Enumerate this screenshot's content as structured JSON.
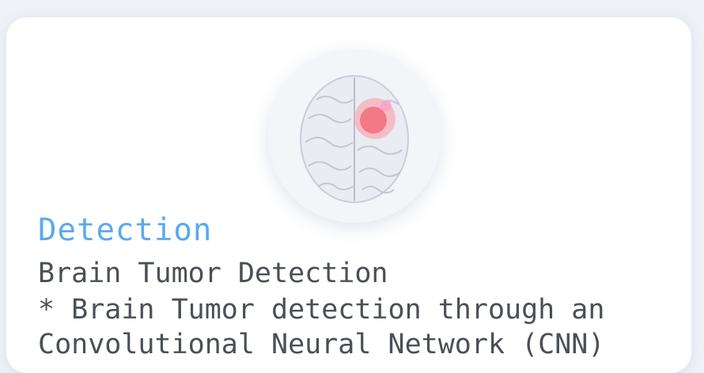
{
  "card": {
    "image": {
      "icon": "brain-scan-tumor-illustration",
      "highlight_color": "#f26d7a"
    },
    "category": "Detection",
    "title": "Brain Tumor Detection",
    "description": "* Brain Tumor detection through an\nConvolutional Neural Network (CNN)"
  },
  "colors": {
    "accent": "#5aa9ee",
    "text": "#4b4f57",
    "card_bg": "#ffffff",
    "page_bg": "#eef2f6"
  }
}
